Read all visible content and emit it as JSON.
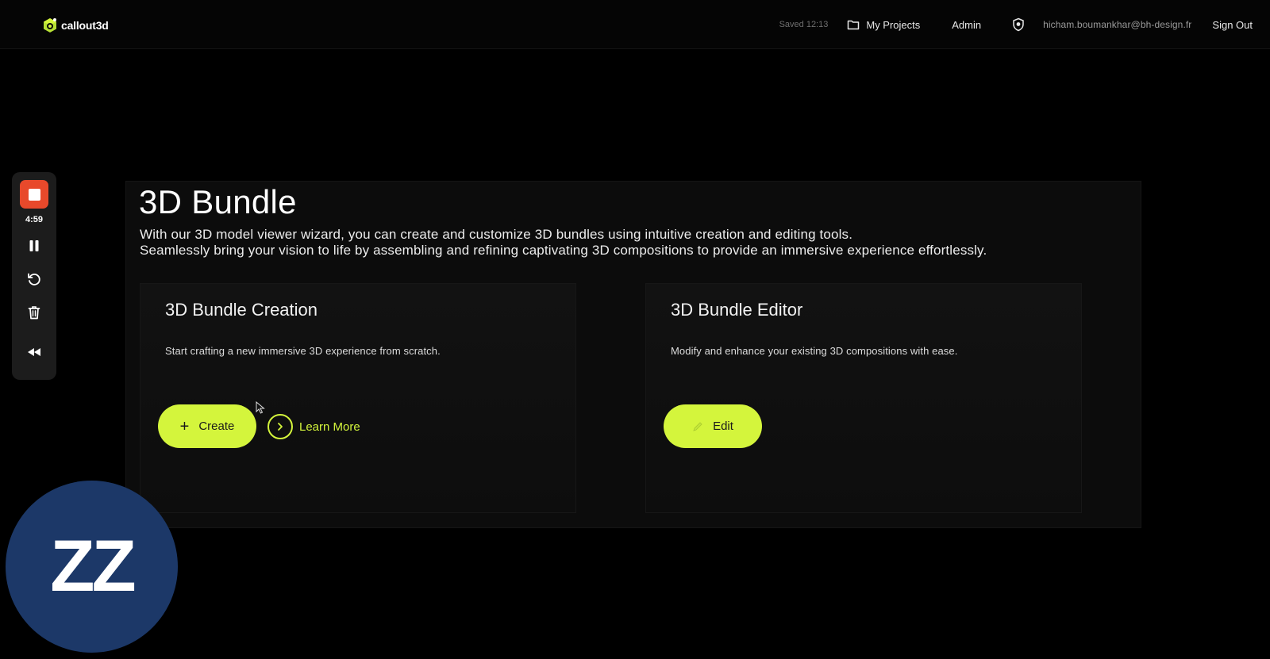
{
  "header": {
    "logo_text": "callout3d",
    "saved_status": "Saved 12:13",
    "my_projects": "My Projects",
    "admin": "Admin",
    "user_email": "hicham.boumankhar@bh-design.fr",
    "sign_out": "Sign Out"
  },
  "recorder": {
    "timer": "4:59",
    "icons": [
      "stop-icon",
      "pause-icon",
      "restart-icon",
      "trash-icon",
      "collapse-icon"
    ],
    "stop_color": "#e8492b"
  },
  "main": {
    "title": "3D Bundle",
    "description_line1": "With our 3D model viewer wizard, you can create and customize 3D bundles using intuitive creation and editing tools.",
    "description_line2": "Seamlessly bring your vision to life by assembling and refining captivating 3D compositions to provide an immersive experience effortlessly.",
    "cards": [
      {
        "title": "3D Bundle Creation",
        "description": "Start crafting a new immersive 3D experience from scratch.",
        "primary_button": "Create",
        "secondary_link": "Learn More"
      },
      {
        "title": "3D Bundle Editor",
        "description": "Modify and enhance your existing 3D compositions with ease.",
        "primary_button": "Edit"
      }
    ]
  },
  "avatar": {
    "initials": "ZZ",
    "background": "#1c3868"
  },
  "colors": {
    "accent": "#d4f53c",
    "background": "#000000",
    "card": "#121212"
  }
}
